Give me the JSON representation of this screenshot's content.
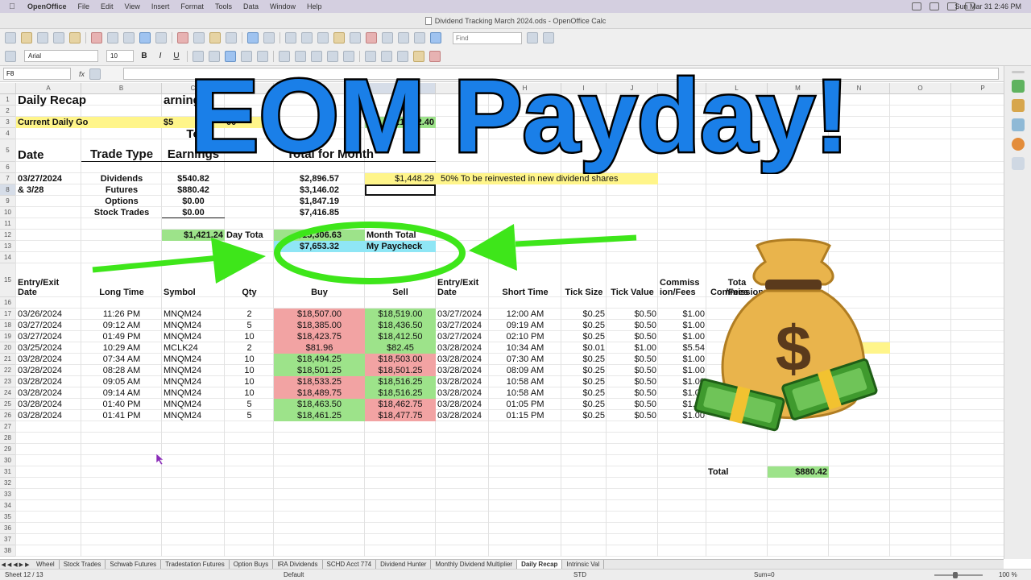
{
  "menubar": {
    "app_name": "OpenOffice",
    "items": [
      "File",
      "Edit",
      "View",
      "Insert",
      "Format",
      "Tools",
      "Data",
      "Window",
      "Help"
    ],
    "clock": "Sun Mar 31  2:46 PM"
  },
  "window": {
    "title": "Dividend Tracking March 2024.ods - OpenOffice Calc"
  },
  "toolbar": {
    "find_placeholder": "Find",
    "font_name": "Arial",
    "font_size": "10",
    "bold": "B",
    "italic": "I",
    "underline": "U"
  },
  "formula_bar": {
    "cell_ref": "F8",
    "fx": "fx"
  },
  "columns": [
    "A",
    "B",
    "C",
    "D",
    "E",
    "F",
    "G",
    "H",
    "I",
    "J",
    "K",
    "L",
    "M",
    "N",
    "O",
    "P"
  ],
  "selected_column": "F",
  "rows": [
    "1",
    "2",
    "3",
    "4",
    "5",
    "6",
    "7",
    "8",
    "9",
    "10",
    "11",
    "12",
    "13",
    "14",
    "15",
    "16",
    "17",
    "18",
    "19",
    "20",
    "21",
    "22",
    "23",
    "24",
    "25",
    "26",
    "27",
    "28",
    "29",
    "30",
    "31",
    "32",
    "33",
    "34",
    "35",
    "36",
    "37",
    "38"
  ],
  "selected_row": "8",
  "sheet": {
    "title": "Daily Recap",
    "title_tail": "arnings",
    "current_daily_goal_label": "Current Daily Go",
    "current_daily_goal_value": "$5",
    "current_daily_goal_value_tail": "00",
    "month_total_right": "21,252.40",
    "header_date": "Date",
    "header_trade_type": "Trade Type",
    "header_earnings_1": "To",
    "header_earnings_2": "Earnings",
    "header_total_month": "Total for Month",
    "date_1": "03/27/2024",
    "date_2": "& 3/28",
    "trade_types": [
      "Dividends",
      "Futures",
      "Options",
      "Stock Trades"
    ],
    "earnings": [
      "$540.82",
      "$880.42",
      "$0.00",
      "$0.00"
    ],
    "month_totals": [
      "$2,896.57",
      "$3,146.02",
      "$1,847.19",
      "$7,416.85"
    ],
    "reinvest_amount": "$1,448.29",
    "reinvest_note": "50% To be reinvested in new dividend shares",
    "day_total_value": "$1,421.24",
    "day_total_label": "Day Tota",
    "month_total_value": "$15,306.63",
    "month_total_label": "Month Total",
    "paycheck_value": "$7,653.32",
    "paycheck_label": "My Paycheck",
    "trades_header": {
      "entry_exit": "Entry/Exit",
      "date": "Date",
      "long_time": "Long Time",
      "symbol": "Symbol",
      "qty": "Qty",
      "buy": "Buy",
      "sell": "Sell",
      "entry_exit_2": "Entry/Exit",
      "date_2": "Date",
      "short_time": "Short Time",
      "tick_size": "Tick Size",
      "tick_value": "Tick Value",
      "commiss_1": "Commiss",
      "commiss_2": "ion/Fees",
      "total_1": "Tota",
      "total_2": "Commission",
      "total_3": "/Fees",
      "total_4": "s"
    },
    "trades": [
      {
        "date": "03/26/2024",
        "time": "11:26 PM",
        "symbol": "MNQM24",
        "qty": "2",
        "buy": "$18,507.00",
        "buy_c": "r",
        "sell": "$18,519.00",
        "sell_c": "g",
        "date2": "03/27/2024",
        "time2": "12:00 AM",
        "tick": "$0.25",
        "tickv": "$0.50",
        "comm": "$1.00"
      },
      {
        "date": "03/27/2024",
        "time": "09:12 AM",
        "symbol": "MNQM24",
        "qty": "5",
        "buy": "$18,385.00",
        "buy_c": "r",
        "sell": "$18,436.50",
        "sell_c": "g",
        "date2": "03/27/2024",
        "time2": "09:19 AM",
        "tick": "$0.25",
        "tickv": "$0.50",
        "comm": "$1.00"
      },
      {
        "date": "03/27/2024",
        "time": "01:49 PM",
        "symbol": "MNQM24",
        "qty": "10",
        "buy": "$18,423.75",
        "buy_c": "r",
        "sell": "$18,412.50",
        "sell_c": "g",
        "date2": "03/27/2024",
        "time2": "02:10 PM",
        "tick": "$0.25",
        "tickv": "$0.50",
        "comm": "$1.00"
      },
      {
        "date": "03/25/2024",
        "time": "10:29 AM",
        "symbol": "MCLK24",
        "qty": "2",
        "buy": "$81.96",
        "buy_c": "r",
        "sell": "$82.45",
        "sell_c": "g",
        "date2": "03/28/2024",
        "time2": "10:34 AM",
        "tick": "$0.01",
        "tickv": "$1.00",
        "comm": "$5.54"
      },
      {
        "date": "03/28/2024",
        "time": "07:34 AM",
        "symbol": "MNQM24",
        "qty": "10",
        "buy": "$18,494.25",
        "buy_c": "g",
        "sell": "$18,503.00",
        "sell_c": "r",
        "date2": "03/28/2024",
        "time2": "07:30 AM",
        "tick": "$0.25",
        "tickv": "$0.50",
        "comm": "$1.00"
      },
      {
        "date": "03/28/2024",
        "time": "08:28 AM",
        "symbol": "MNQM24",
        "qty": "10",
        "buy": "$18,501.25",
        "buy_c": "g",
        "sell": "$18,501.25",
        "sell_c": "r",
        "date2": "03/28/2024",
        "time2": "08:09 AM",
        "tick": "$0.25",
        "tickv": "$0.50",
        "comm": "$1.00"
      },
      {
        "date": "03/28/2024",
        "time": "09:05 AM",
        "symbol": "MNQM24",
        "qty": "10",
        "buy": "$18,533.25",
        "buy_c": "r",
        "sell": "$18,516.25",
        "sell_c": "g",
        "date2": "03/28/2024",
        "time2": "10:58 AM",
        "tick": "$0.25",
        "tickv": "$0.50",
        "comm": "$1.00"
      },
      {
        "date": "03/28/2024",
        "time": "09:14 AM",
        "symbol": "MNQM24",
        "qty": "10",
        "buy": "$18,489.75",
        "buy_c": "r",
        "sell": "$18,516.25",
        "sell_c": "g",
        "date2": "03/28/2024",
        "time2": "10:58 AM",
        "tick": "$0.25",
        "tickv": "$0.50",
        "comm": "$1.00"
      },
      {
        "date": "03/28/2024",
        "time": "01:40 PM",
        "symbol": "MNQM24",
        "qty": "5",
        "buy": "$18,463.50",
        "buy_c": "g",
        "sell": "$18,462.75",
        "sell_c": "r",
        "date2": "03/28/2024",
        "time2": "01:05 PM",
        "tick": "$0.25",
        "tickv": "$0.50",
        "comm": "$1.00"
      },
      {
        "date": "03/28/2024",
        "time": "01:41 PM",
        "symbol": "MNQM24",
        "qty": "5",
        "buy": "$18,461.25",
        "buy_c": "g",
        "sell": "$18,477.75",
        "sell_c": "r",
        "date2": "03/28/2024",
        "time2": "01:15 PM",
        "tick": "$0.25",
        "tickv": "$0.50",
        "comm": "$1.00"
      }
    ],
    "total_label": "Total",
    "total_value": "$880.42"
  },
  "overlay": {
    "headline": "EOM Payday!",
    "headline_color": "#1a7fe8",
    "ring_color": "#3ee61a"
  },
  "sheet_tabs": [
    "Wheel",
    "Stock Trades",
    "Schwab Futures",
    "Tradestation Futures",
    "Option Buys",
    "IRA Dividends",
    "SCHD Acct 774",
    "Dividend Hunter",
    "Monthly Dividend Multiplier",
    "Daily Recap",
    "Intrinsic Val"
  ],
  "active_tab": "Daily Recap",
  "status": {
    "sheet": "Sheet 12 / 13",
    "style": "Default",
    "mode": "STD",
    "sum": "Sum=0",
    "zoom": "100 %"
  }
}
